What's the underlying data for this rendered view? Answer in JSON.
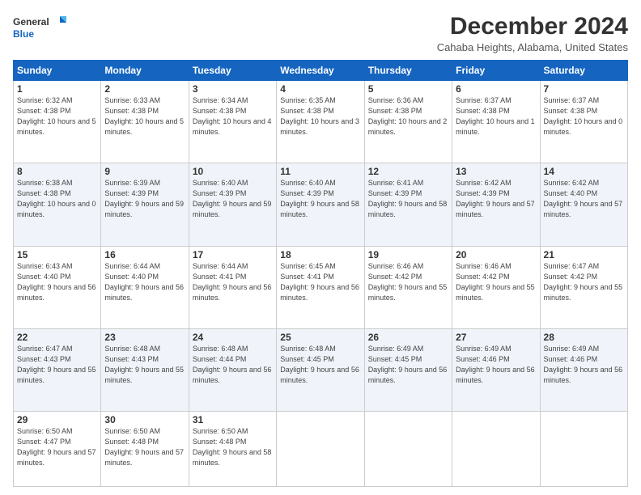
{
  "logo": {
    "line1": "General",
    "line2": "Blue"
  },
  "title": "December 2024",
  "subtitle": "Cahaba Heights, Alabama, United States",
  "days_header": [
    "Sunday",
    "Monday",
    "Tuesday",
    "Wednesday",
    "Thursday",
    "Friday",
    "Saturday"
  ],
  "weeks": [
    [
      {
        "num": "1",
        "sunrise": "6:32 AM",
        "sunset": "4:38 PM",
        "daylight": "10 hours and 5 minutes."
      },
      {
        "num": "2",
        "sunrise": "6:33 AM",
        "sunset": "4:38 PM",
        "daylight": "10 hours and 5 minutes."
      },
      {
        "num": "3",
        "sunrise": "6:34 AM",
        "sunset": "4:38 PM",
        "daylight": "10 hours and 4 minutes."
      },
      {
        "num": "4",
        "sunrise": "6:35 AM",
        "sunset": "4:38 PM",
        "daylight": "10 hours and 3 minutes."
      },
      {
        "num": "5",
        "sunrise": "6:36 AM",
        "sunset": "4:38 PM",
        "daylight": "10 hours and 2 minutes."
      },
      {
        "num": "6",
        "sunrise": "6:37 AM",
        "sunset": "4:38 PM",
        "daylight": "10 hours and 1 minute."
      },
      {
        "num": "7",
        "sunrise": "6:37 AM",
        "sunset": "4:38 PM",
        "daylight": "10 hours and 0 minutes."
      }
    ],
    [
      {
        "num": "8",
        "sunrise": "6:38 AM",
        "sunset": "4:38 PM",
        "daylight": "10 hours and 0 minutes."
      },
      {
        "num": "9",
        "sunrise": "6:39 AM",
        "sunset": "4:39 PM",
        "daylight": "9 hours and 59 minutes."
      },
      {
        "num": "10",
        "sunrise": "6:40 AM",
        "sunset": "4:39 PM",
        "daylight": "9 hours and 59 minutes."
      },
      {
        "num": "11",
        "sunrise": "6:40 AM",
        "sunset": "4:39 PM",
        "daylight": "9 hours and 58 minutes."
      },
      {
        "num": "12",
        "sunrise": "6:41 AM",
        "sunset": "4:39 PM",
        "daylight": "9 hours and 58 minutes."
      },
      {
        "num": "13",
        "sunrise": "6:42 AM",
        "sunset": "4:39 PM",
        "daylight": "9 hours and 57 minutes."
      },
      {
        "num": "14",
        "sunrise": "6:42 AM",
        "sunset": "4:40 PM",
        "daylight": "9 hours and 57 minutes."
      }
    ],
    [
      {
        "num": "15",
        "sunrise": "6:43 AM",
        "sunset": "4:40 PM",
        "daylight": "9 hours and 56 minutes."
      },
      {
        "num": "16",
        "sunrise": "6:44 AM",
        "sunset": "4:40 PM",
        "daylight": "9 hours and 56 minutes."
      },
      {
        "num": "17",
        "sunrise": "6:44 AM",
        "sunset": "4:41 PM",
        "daylight": "9 hours and 56 minutes."
      },
      {
        "num": "18",
        "sunrise": "6:45 AM",
        "sunset": "4:41 PM",
        "daylight": "9 hours and 56 minutes."
      },
      {
        "num": "19",
        "sunrise": "6:46 AM",
        "sunset": "4:42 PM",
        "daylight": "9 hours and 55 minutes."
      },
      {
        "num": "20",
        "sunrise": "6:46 AM",
        "sunset": "4:42 PM",
        "daylight": "9 hours and 55 minutes."
      },
      {
        "num": "21",
        "sunrise": "6:47 AM",
        "sunset": "4:42 PM",
        "daylight": "9 hours and 55 minutes."
      }
    ],
    [
      {
        "num": "22",
        "sunrise": "6:47 AM",
        "sunset": "4:43 PM",
        "daylight": "9 hours and 55 minutes."
      },
      {
        "num": "23",
        "sunrise": "6:48 AM",
        "sunset": "4:43 PM",
        "daylight": "9 hours and 55 minutes."
      },
      {
        "num": "24",
        "sunrise": "6:48 AM",
        "sunset": "4:44 PM",
        "daylight": "9 hours and 56 minutes."
      },
      {
        "num": "25",
        "sunrise": "6:48 AM",
        "sunset": "4:45 PM",
        "daylight": "9 hours and 56 minutes."
      },
      {
        "num": "26",
        "sunrise": "6:49 AM",
        "sunset": "4:45 PM",
        "daylight": "9 hours and 56 minutes."
      },
      {
        "num": "27",
        "sunrise": "6:49 AM",
        "sunset": "4:46 PM",
        "daylight": "9 hours and 56 minutes."
      },
      {
        "num": "28",
        "sunrise": "6:49 AM",
        "sunset": "4:46 PM",
        "daylight": "9 hours and 56 minutes."
      }
    ],
    [
      {
        "num": "29",
        "sunrise": "6:50 AM",
        "sunset": "4:47 PM",
        "daylight": "9 hours and 57 minutes."
      },
      {
        "num": "30",
        "sunrise": "6:50 AM",
        "sunset": "4:48 PM",
        "daylight": "9 hours and 57 minutes."
      },
      {
        "num": "31",
        "sunrise": "6:50 AM",
        "sunset": "4:48 PM",
        "daylight": "9 hours and 58 minutes."
      },
      null,
      null,
      null,
      null
    ]
  ]
}
